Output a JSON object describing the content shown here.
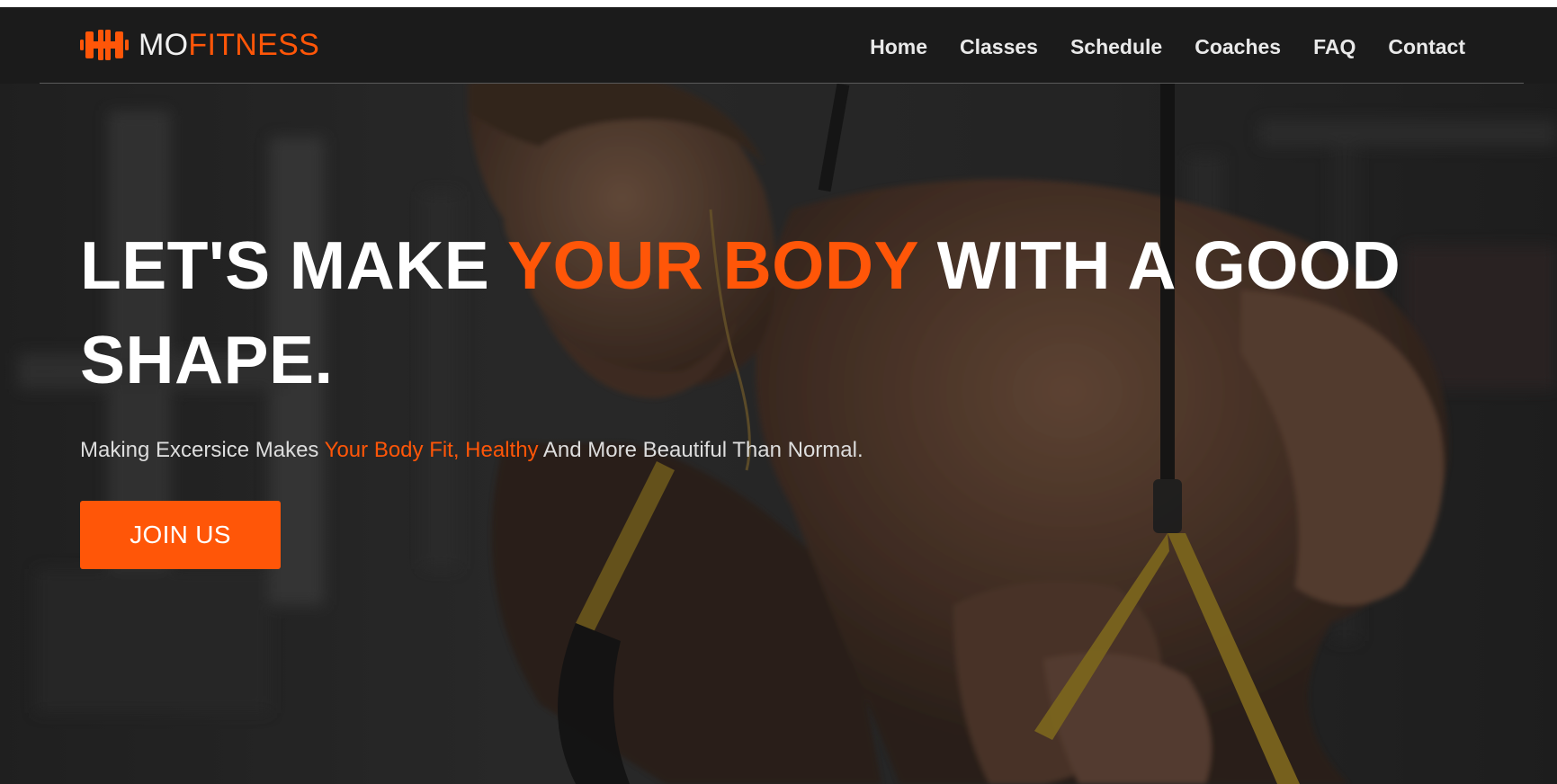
{
  "brand": {
    "logo_icon": "dumbbell-icon",
    "name_part1": "MO",
    "name_part2": "FITNESS"
  },
  "nav": {
    "items": [
      {
        "label": "Home"
      },
      {
        "label": "Classes"
      },
      {
        "label": "Schedule"
      },
      {
        "label": "Coaches"
      },
      {
        "label": "FAQ"
      },
      {
        "label": "Contact"
      }
    ]
  },
  "hero": {
    "headline_part1": "LET'S MAKE ",
    "headline_accent": "YOUR BODY",
    "headline_part2": " WITH A GOOD SHAPE.",
    "sub_part1": "Making Excersice Makes ",
    "sub_accent": "Your Body Fit, Healthy",
    "sub_part2": " And More Beautiful Than Normal.",
    "cta_label": "JOIN US",
    "background_image": "man-doing-trx-pushups-in-gym"
  },
  "colors": {
    "accent": "#ff5608",
    "header_bg": "#1b1b1b",
    "nav_text": "#e9e9e9"
  }
}
